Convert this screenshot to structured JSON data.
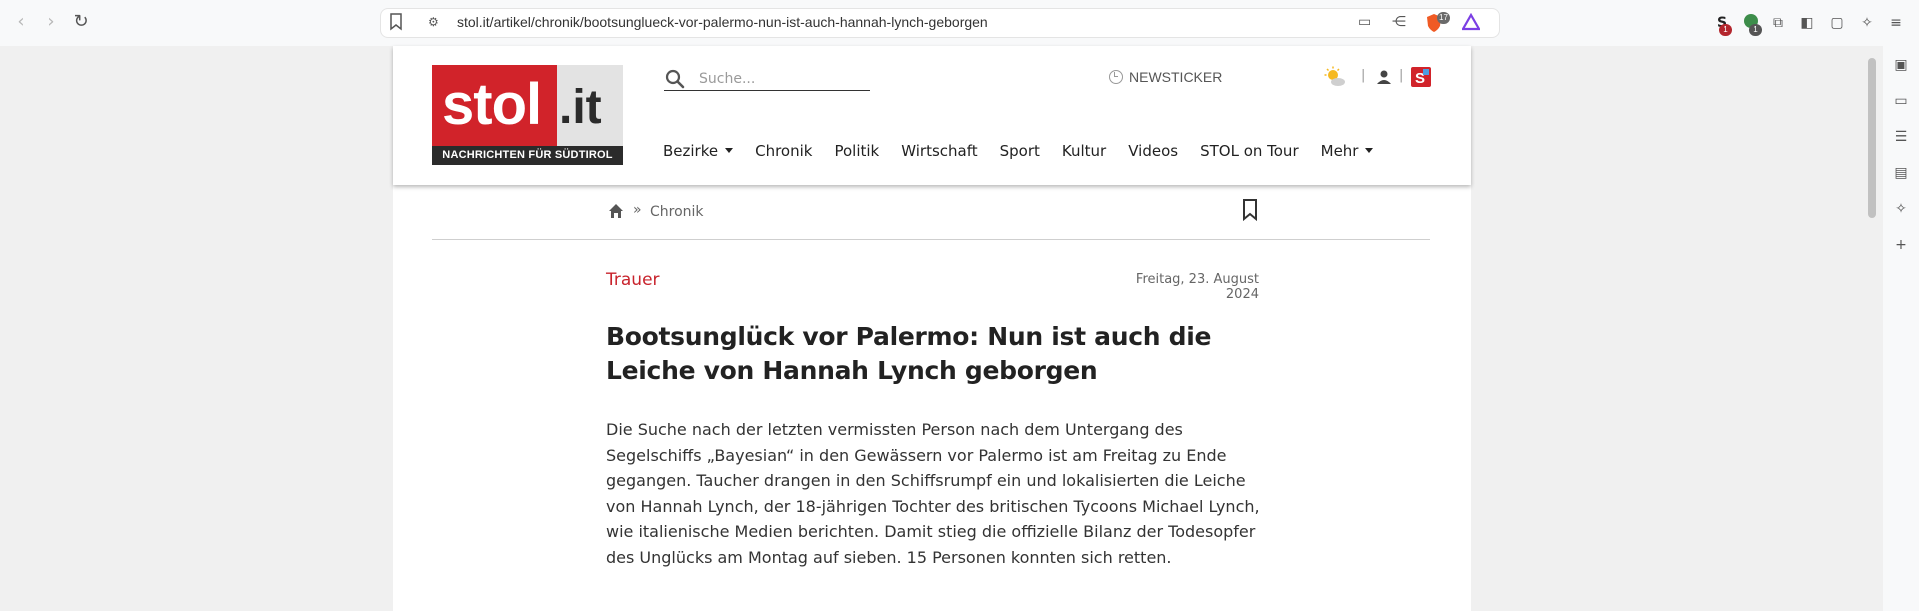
{
  "browser": {
    "url": "stol.it/artikel/chronik/bootsunglueck-vor-palermo-nun-ist-auch-hannah-lynch-geborgen",
    "brave_badge": "17",
    "ext_badge_1": "1",
    "ext_badge_2": "1"
  },
  "logo": {
    "stol": "stol",
    "it": ".it",
    "tagline": "NACHRICHTEN FÜR SÜDTIROL"
  },
  "search": {
    "placeholder": "Suche..."
  },
  "newsticker": "NEWSTICKER",
  "nav": {
    "items": [
      {
        "label": "Bezirke",
        "dropdown": true
      },
      {
        "label": "Chronik"
      },
      {
        "label": "Politik"
      },
      {
        "label": "Wirtschaft"
      },
      {
        "label": "Sport"
      },
      {
        "label": "Kultur"
      },
      {
        "label": "Videos"
      },
      {
        "label": "STOL on Tour"
      },
      {
        "label": "Mehr",
        "dropdown": true
      }
    ]
  },
  "breadcrumb": {
    "separator": "»",
    "category": "Chronik"
  },
  "article": {
    "kicker": "Trauer",
    "date": "Freitag, 23. August 2024",
    "headline": "Bootsunglück vor Palermo: Nun ist auch die Leiche von Hannah Lynch geborgen",
    "lead": "Die Suche nach der letzten vermissten Person nach dem Untergang des Segelschiffs „Bayesian“ in den Gewässern vor Palermo ist am Freitag zu Ende gegangen. Taucher drangen in den Schiffsrumpf ein und lokalisierten die Leiche von Hannah Lynch, der 18-jährigen Tochter des britischen Tycoons Michael Lynch, wie italienische Medien berichten. Damit stieg die offizielle Bilanz der Todesopfer des Unglücks am Montag auf sieben. 15 Personen konnten sich retten."
  },
  "colors": {
    "brand_red": "#d1232a",
    "kicker_red": "#c8232c",
    "logo_dark": "#2b2b2b"
  }
}
